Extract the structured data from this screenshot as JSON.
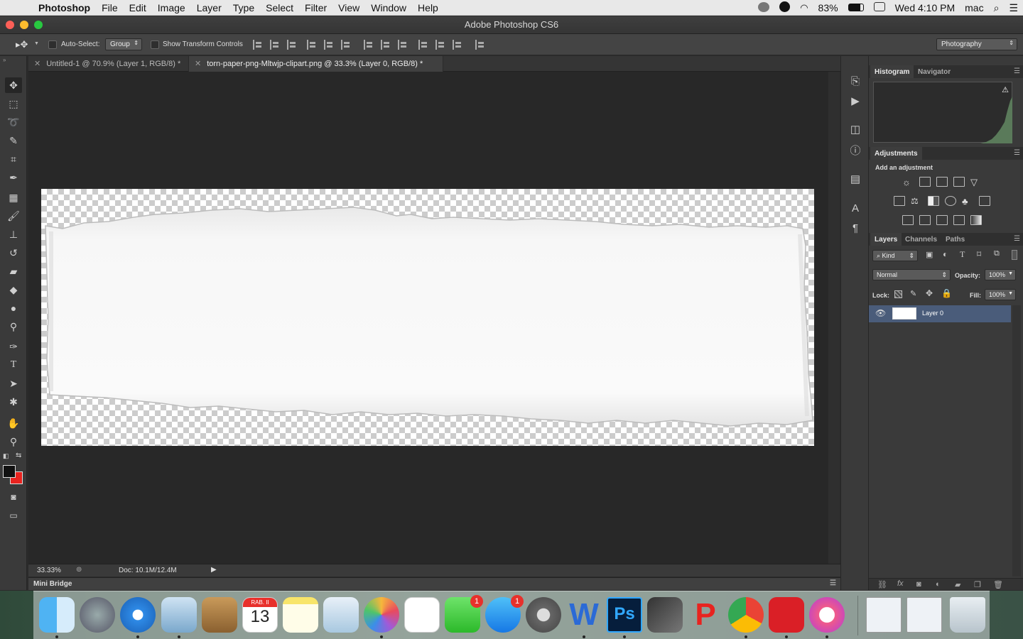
{
  "menubar": {
    "app_name": "Photoshop",
    "items": [
      "File",
      "Edit",
      "Image",
      "Layer",
      "Type",
      "Select",
      "Filter",
      "View",
      "Window",
      "Help"
    ],
    "battery": "83%",
    "clock": "Wed 4:10 PM",
    "user": "mac"
  },
  "window": {
    "title": "Adobe Photoshop CS6"
  },
  "options_bar": {
    "auto_select_label": "Auto-Select:",
    "auto_select_value": "Group",
    "show_transform_label": "Show Transform Controls",
    "workspace": "Photography"
  },
  "tabs": [
    {
      "label": "Untitled-1 @ 70.9% (Layer 1, RGB/8) *"
    },
    {
      "label": "torn-paper-png-Mltwjp-clipart.png @ 33.3% (Layer 0, RGB/8) *"
    }
  ],
  "status": {
    "zoom": "33.33%",
    "doc": "Doc: 10.1M/12.4M"
  },
  "mini_bridge": "Mini Bridge",
  "panels": {
    "histogram_tab": "Histogram",
    "navigator_tab": "Navigator",
    "adjustments_tab": "Adjustments",
    "add_adjustment": "Add an adjustment",
    "layers_tab": "Layers",
    "channels_tab": "Channels",
    "paths_tab": "Paths",
    "kind_filter": "Kind",
    "blend_mode": "Normal",
    "opacity_label": "Opacity:",
    "opacity_value": "100%",
    "lock_label": "Lock:",
    "fill_label": "Fill:",
    "fill_value": "100%",
    "layer_name": "Layer 0"
  },
  "dock": {
    "calendar_month": "RAB. II",
    "calendar_day": "13",
    "facetime_badge": "1",
    "appstore_badge": "1"
  },
  "colors": {
    "foreground": "#111111",
    "background": "#e8231f",
    "selection": "#4a5c7a"
  }
}
